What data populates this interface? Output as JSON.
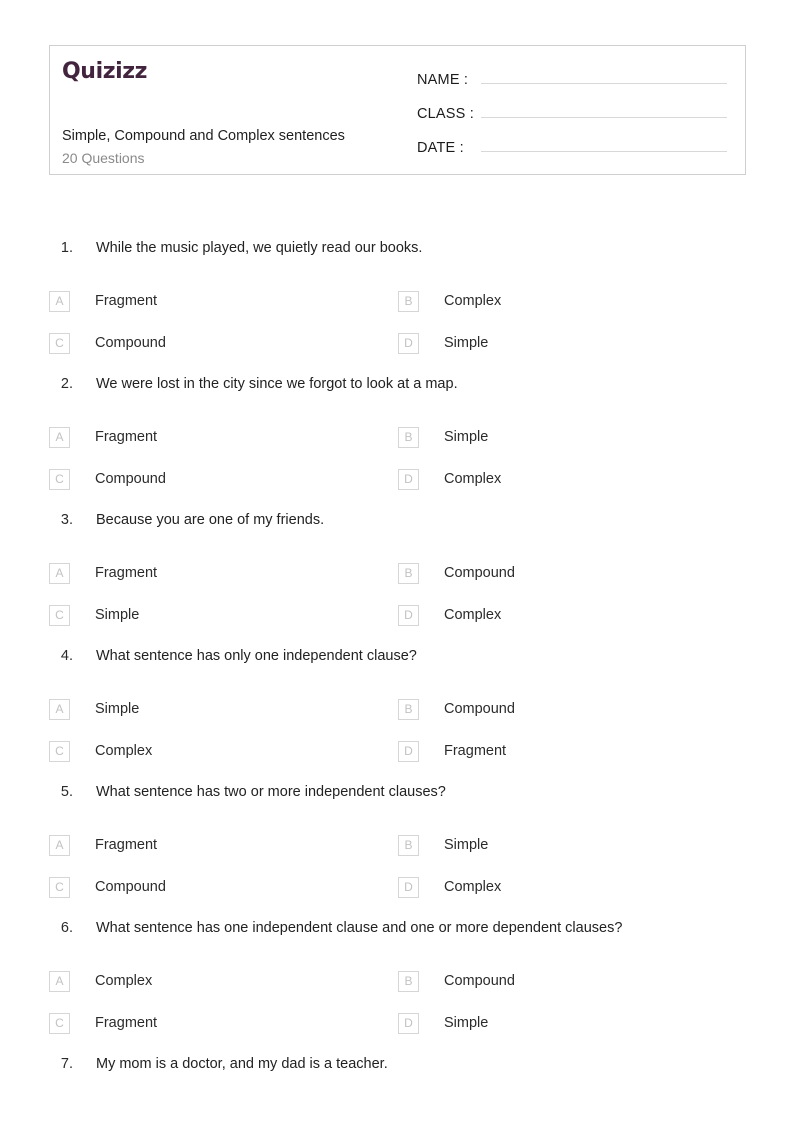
{
  "header": {
    "brand": "Quizizz",
    "title": "Simple, Compound and Complex sentences",
    "subtitle": "20 Questions",
    "fields": [
      {
        "label": "NAME :",
        "value": ""
      },
      {
        "label": "CLASS :",
        "value": ""
      },
      {
        "label": "DATE  :",
        "value": ""
      }
    ],
    "brand_color": "#43243f",
    "border_color": "#cfcfcf"
  },
  "questions": [
    {
      "number": "1.",
      "text": "While the music played, we quietly read our books.",
      "options": [
        {
          "letter": "A",
          "label": "Fragment"
        },
        {
          "letter": "B",
          "label": "Complex"
        },
        {
          "letter": "C",
          "label": "Compound"
        },
        {
          "letter": "D",
          "label": "Simple"
        }
      ]
    },
    {
      "number": "2.",
      "text": "We were lost in the city since we forgot to look at a map.",
      "options": [
        {
          "letter": "A",
          "label": "Fragment"
        },
        {
          "letter": "B",
          "label": "Simple"
        },
        {
          "letter": "C",
          "label": "Compound"
        },
        {
          "letter": "D",
          "label": "Complex"
        }
      ]
    },
    {
      "number": "3.",
      "text": "Because you are one of my friends.",
      "options": [
        {
          "letter": "A",
          "label": "Fragment"
        },
        {
          "letter": "B",
          "label": "Compound"
        },
        {
          "letter": "C",
          "label": "Simple"
        },
        {
          "letter": "D",
          "label": "Complex"
        }
      ]
    },
    {
      "number": "4.",
      "text": "What sentence has only one independent clause?",
      "options": [
        {
          "letter": "A",
          "label": "Simple"
        },
        {
          "letter": "B",
          "label": "Compound"
        },
        {
          "letter": "C",
          "label": "Complex"
        },
        {
          "letter": "D",
          "label": "Fragment"
        }
      ]
    },
    {
      "number": "5.",
      "text": "What sentence has two or more independent clauses?",
      "options": [
        {
          "letter": "A",
          "label": "Fragment"
        },
        {
          "letter": "B",
          "label": "Simple"
        },
        {
          "letter": "C",
          "label": "Compound"
        },
        {
          "letter": "D",
          "label": "Complex"
        }
      ]
    },
    {
      "number": "6.",
      "text": "What sentence has one independent clause and one or more dependent clauses?",
      "options": [
        {
          "letter": "A",
          "label": "Complex"
        },
        {
          "letter": "B",
          "label": "Compound"
        },
        {
          "letter": "C",
          "label": "Fragment"
        },
        {
          "letter": "D",
          "label": "Simple"
        }
      ]
    },
    {
      "number": "7.",
      "text": "My mom is a doctor, and my dad is a teacher.",
      "options": []
    }
  ]
}
